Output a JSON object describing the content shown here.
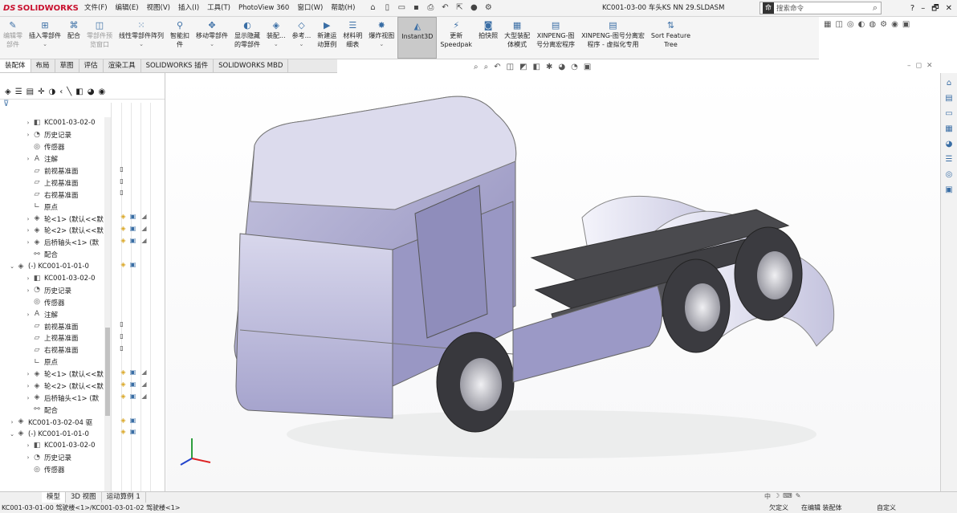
{
  "app": {
    "logo": "SOLIDWORKS",
    "logo_mark": "DS"
  },
  "menu": [
    "文件(F)",
    "编辑(E)",
    "视图(V)",
    "插入(I)",
    "工具(T)",
    "PhotoView 360",
    "窗口(W)",
    "帮助(H)"
  ],
  "doc_title": "KC001-03-00 车头KS NN 29.SLDASM",
  "search": {
    "placeholder": "搜索命令",
    "term_icon": "命"
  },
  "win": [
    "?",
    "–",
    "🗗",
    "✕"
  ],
  "ribbon": [
    {
      "label": "编辑零\n部件",
      "icon": "pencil-icon",
      "disabled": true
    },
    {
      "label": "插入零部件",
      "icon": "insert-component-icon",
      "dd": true
    },
    {
      "label": "配合",
      "icon": "mate-icon"
    },
    {
      "label": "零部件预\n览窗口",
      "icon": "preview-icon",
      "disabled": true
    },
    {
      "label": "线性零部件阵列",
      "icon": "pattern-icon",
      "dd": true
    },
    {
      "label": "智能扣\n件",
      "icon": "fastener-icon"
    },
    {
      "label": "移动零部件",
      "icon": "move-icon",
      "dd": true
    },
    {
      "label": "显示隐藏\n的零部件",
      "icon": "show-hidden-icon"
    },
    {
      "label": "装配...",
      "icon": "assembly-icon",
      "dd": true
    },
    {
      "label": "参考...",
      "icon": "reference-icon",
      "dd": true
    },
    {
      "label": "新建运\n动算例",
      "icon": "motion-icon"
    },
    {
      "label": "材料明\n细表",
      "icon": "bom-icon"
    },
    {
      "label": "爆炸视图",
      "icon": "explode-icon",
      "dd": true
    },
    {
      "label": "Instant3D",
      "icon": "instant3d-icon",
      "active": true
    },
    {
      "label": "更新\nSpeedpak",
      "icon": "speedpak-icon"
    },
    {
      "label": "拍快照",
      "icon": "camera-icon"
    },
    {
      "label": "大型装配\n体模式",
      "icon": "large-assembly-icon"
    },
    {
      "label": "XINPENG-图\n号分离宏程序",
      "icon": "macro-icon"
    },
    {
      "label": "XINPENG-图号分离宏\n程序 - 虚拟化专用",
      "icon": "macro-icon"
    },
    {
      "label": "Sort Feature\nTree",
      "icon": "sort-icon"
    }
  ],
  "tabs": [
    "装配体",
    "布局",
    "草图",
    "评估",
    "渲染工具",
    "SOLIDWORKS 插件",
    "SOLIDWORKS MBD"
  ],
  "tree": [
    {
      "indent": 3,
      "arrow": "›",
      "icon": "part",
      "label": "KC001-03-02-0"
    },
    {
      "indent": 3,
      "arrow": "›",
      "icon": "history",
      "label": "历史记录"
    },
    {
      "indent": 3,
      "arrow": "",
      "icon": "sensor",
      "label": "传感器"
    },
    {
      "indent": 3,
      "arrow": "›",
      "icon": "note",
      "label": "注解"
    },
    {
      "indent": 3,
      "arrow": "",
      "icon": "plane",
      "label": "前视基准面"
    },
    {
      "indent": 3,
      "arrow": "",
      "icon": "plane",
      "label": "上视基准面"
    },
    {
      "indent": 3,
      "arrow": "",
      "icon": "plane",
      "label": "右视基准面"
    },
    {
      "indent": 3,
      "arrow": "",
      "icon": "origin",
      "label": "原点"
    },
    {
      "indent": 3,
      "arrow": "›",
      "icon": "assembly",
      "label": "轮<1> (默认<<默"
    },
    {
      "indent": 3,
      "arrow": "›",
      "icon": "assembly",
      "label": "轮<2> (默认<<默"
    },
    {
      "indent": 3,
      "arrow": "›",
      "icon": "assembly",
      "label": "后桥轴头<1> (默"
    },
    {
      "indent": 3,
      "arrow": "",
      "icon": "mate",
      "label": "配合"
    },
    {
      "indent": 1,
      "arrow": "⌄",
      "icon": "assembly",
      "label": "(-) KC001-01-01-0"
    },
    {
      "indent": 3,
      "arrow": "›",
      "icon": "part",
      "label": "KC001-03-02-0"
    },
    {
      "indent": 3,
      "arrow": "›",
      "icon": "history",
      "label": "历史记录"
    },
    {
      "indent": 3,
      "arrow": "",
      "icon": "sensor",
      "label": "传感器"
    },
    {
      "indent": 3,
      "arrow": "›",
      "icon": "note",
      "label": "注解"
    },
    {
      "indent": 3,
      "arrow": "",
      "icon": "plane",
      "label": "前视基准面"
    },
    {
      "indent": 3,
      "arrow": "",
      "icon": "plane",
      "label": "上视基准面"
    },
    {
      "indent": 3,
      "arrow": "",
      "icon": "plane",
      "label": "右视基准面"
    },
    {
      "indent": 3,
      "arrow": "",
      "icon": "origin",
      "label": "原点"
    },
    {
      "indent": 3,
      "arrow": "›",
      "icon": "assembly",
      "label": "轮<1> (默认<<默"
    },
    {
      "indent": 3,
      "arrow": "›",
      "icon": "assembly",
      "label": "轮<2> (默认<<默"
    },
    {
      "indent": 3,
      "arrow": "›",
      "icon": "assembly",
      "label": "后桥轴头<1> (默"
    },
    {
      "indent": 3,
      "arrow": "",
      "icon": "mate",
      "label": "配合"
    },
    {
      "indent": 1,
      "arrow": "›",
      "icon": "assembly",
      "label": "KC001-03-02-04 驱"
    },
    {
      "indent": 1,
      "arrow": "⌄",
      "icon": "assembly",
      "label": "(-) KC001-01-01-0"
    },
    {
      "indent": 3,
      "arrow": "›",
      "icon": "part",
      "label": "KC001-03-02-0"
    },
    {
      "indent": 3,
      "arrow": "›",
      "icon": "history",
      "label": "历史记录"
    },
    {
      "indent": 3,
      "arrow": "",
      "icon": "sensor",
      "label": "传感器"
    }
  ],
  "bottom_tabs": [
    "模型",
    "3D 视图",
    "运动算例 1"
  ],
  "status": {
    "path": "KC001-03-01-00 驾驶楼<1>/KC001-03-01-02 驾驶楼<1>",
    "s1": "欠定义",
    "s2": "在编辑 装配体",
    "s3": "自定义"
  },
  "colors": {
    "accent": "#3a6ea5",
    "body": "#a9a7cf",
    "tire": "#3a3a3e",
    "frame": "#555"
  }
}
